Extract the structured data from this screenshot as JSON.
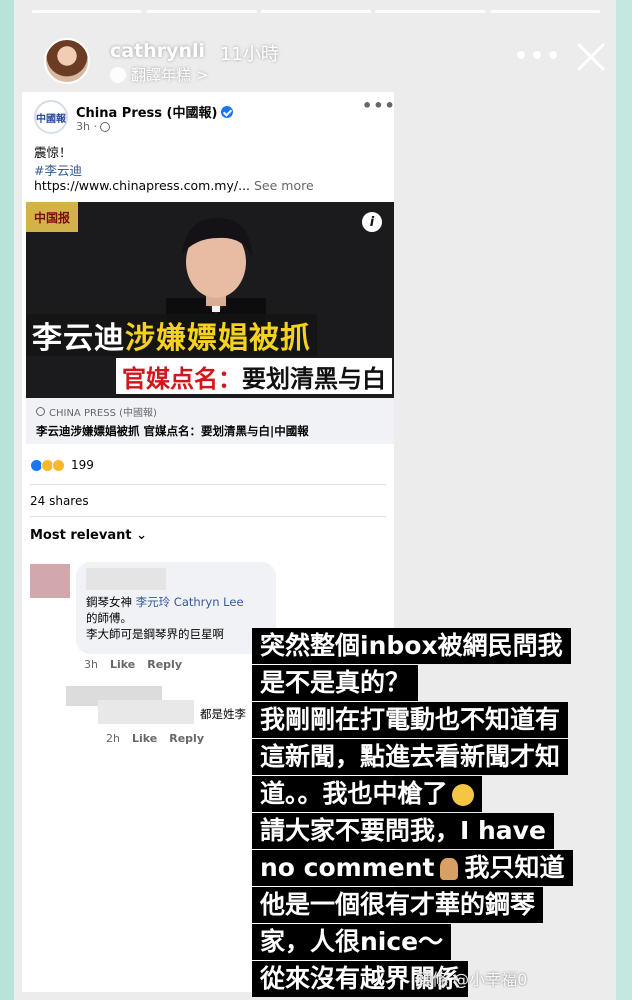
{
  "story": {
    "username": "cathrynli",
    "time": "11小時",
    "translate_label": "翻譯年糕 >",
    "more_icon": "more-horizontal-icon",
    "close_icon": "close-icon"
  },
  "post": {
    "page_name": "China Press (中國報)",
    "avatar_text": "中國報",
    "time": "3h ·",
    "line1": "震惊！",
    "hashtag": "#李云迪",
    "link_text": "https://www.chinapress.com.my/...",
    "see_more": "See more",
    "image": {
      "logo_text": "中国报",
      "headline_white": "李云迪",
      "headline_yellow": "涉嫌嫖娼被抓",
      "subhead_red": "官媒点名：",
      "subhead_black": "要划清黑与白"
    },
    "link_domain": "CHINA PRESS (中國報)",
    "link_title": "李云迪涉嫌嫖娼被抓 官媒点名：要划清黑与白|中國報",
    "reaction_count": "199",
    "shares": "24 shares",
    "sort_label": "Most relevant ⌄"
  },
  "comments": [
    {
      "line1_prefix": "鋼琴女神",
      "mention": "李元玲 Cathryn Lee",
      "line2": "的師傅。",
      "line3": "李大師可是鋼琴界的巨星啊",
      "time": "3h",
      "like": "Like",
      "reply": "Reply"
    },
    {
      "text": "都是姓李",
      "time": "2h",
      "like": "Like",
      "reply": "Reply"
    }
  ],
  "overlay": {
    "lines": [
      "突然整個inbox被網民問我",
      "是不是真的？",
      "我剛剛在打電動也不知道有",
      "這新聞，點進去看新聞才知",
      "道。。我也中槍了",
      "請大家不要問我，I have",
      "no comment",
      "我只知道",
      "他是一個很有才華的鋼琴",
      "家，人很nice～",
      "從來沒有越界關係"
    ]
  },
  "watermark": "頭條 @小幸福0"
}
